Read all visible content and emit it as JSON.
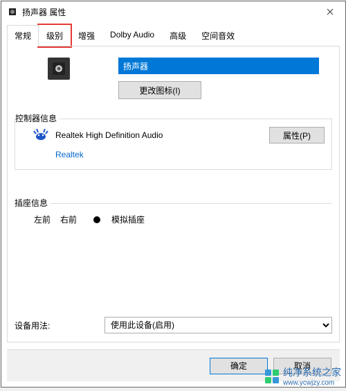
{
  "window": {
    "title": "扬声器 属性"
  },
  "tabs": {
    "items": [
      {
        "label": "常规"
      },
      {
        "label": "级别"
      },
      {
        "label": "增强"
      },
      {
        "label": "Dolby Audio"
      },
      {
        "label": "高级"
      },
      {
        "label": "空间音效"
      }
    ],
    "active_index": 0,
    "highlighted_index": 1
  },
  "general": {
    "device_name": "扬声器",
    "change_icon_label": "更改图标(I)"
  },
  "controller": {
    "legend": "控制器信息",
    "name": "Realtek High Definition Audio",
    "provider": "Realtek",
    "properties_label": "属性(P)"
  },
  "jack": {
    "legend": "插座信息",
    "left": "左前",
    "right": "右前",
    "type": "模拟插座"
  },
  "usage": {
    "label": "设备用法:",
    "value": "使用此设备(启用)"
  },
  "buttons": {
    "ok": "确定",
    "cancel": "取消"
  },
  "watermark": {
    "brand": "纯净系统之家",
    "url": "www.ycwjzy.com"
  }
}
